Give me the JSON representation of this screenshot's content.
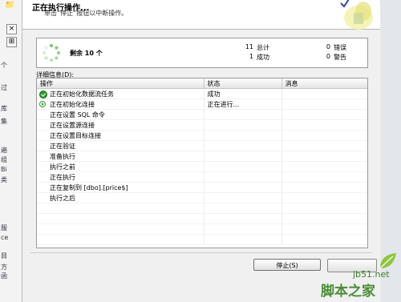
{
  "background": {
    "left_fragments": [
      "个",
      "过",
      "库",
      "集",
      "遍",
      "组",
      "Bi",
      "类",
      "服",
      "ce",
      "目",
      "方",
      "函"
    ],
    "left_buttons": [
      "×",
      "⊞"
    ]
  },
  "dialog": {
    "title": "正在执行操作...",
    "subtitle": "单击“停止”按钮以中断操作。",
    "status": {
      "remaining_label": "剩余 10 个",
      "total_count": "11",
      "total_label": "总计",
      "success_count": "1",
      "success_label": "成功",
      "error_count": "0",
      "error_label": "错误",
      "warning_count": "0",
      "warning_label": "警告"
    },
    "details_label": "详细信息(D):",
    "columns": [
      "操作",
      "状态",
      "消息"
    ],
    "rows": [
      {
        "action": "正在初始化数据流任务",
        "status": "成功",
        "message": "",
        "icon": "success-check-icon"
      },
      {
        "action": "正在初始化连接",
        "status": "正在进行...",
        "message": "",
        "icon": "in-progress-icon"
      },
      {
        "action": "正在设置 SQL 命令",
        "status": "",
        "message": "",
        "icon": ""
      },
      {
        "action": "正在设置源连接",
        "status": "",
        "message": "",
        "icon": ""
      },
      {
        "action": "正在设置目标连接",
        "status": "",
        "message": "",
        "icon": ""
      },
      {
        "action": "正在验证",
        "status": "",
        "message": "",
        "icon": ""
      },
      {
        "action": "准备执行",
        "status": "",
        "message": "",
        "icon": ""
      },
      {
        "action": "执行之前",
        "status": "",
        "message": "",
        "icon": ""
      },
      {
        "action": "正在执行",
        "status": "",
        "message": "",
        "icon": ""
      },
      {
        "action": "正在复制到 [dbo].[price$]",
        "status": "",
        "message": "",
        "icon": ""
      },
      {
        "action": "执行之后",
        "status": "",
        "message": "",
        "icon": ""
      }
    ],
    "stop_button": "停止(S)"
  },
  "watermark": {
    "domain": "jb51.net",
    "text": "脚本之家"
  },
  "colors": {
    "success": "#2e9b2e",
    "watermark": "#4a8c36"
  }
}
